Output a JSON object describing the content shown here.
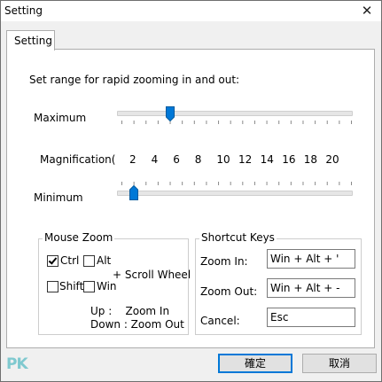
{
  "window": {
    "title": "Setting",
    "close_glyph": "✕"
  },
  "tab": {
    "label": "Setting"
  },
  "range": {
    "heading": "Set range for rapid zooming in and out:",
    "maximum_label": "Maximum",
    "minimum_label": "Minimum",
    "magnification_label": "Magnification(",
    "scale": [
      "2",
      "4",
      "6",
      "8",
      "10",
      "12",
      "14",
      "16",
      "18",
      "20"
    ],
    "maximum_value": 5,
    "minimum_value": 2
  },
  "mouse_zoom": {
    "title": "Mouse Zoom",
    "ctrl_label": "Ctrl",
    "ctrl_checked": true,
    "alt_label": "Alt",
    "alt_checked": false,
    "shift_label": "Shift",
    "shift_checked": false,
    "win_label": "Win",
    "win_checked": false,
    "scroll_label": "+ Scroll Wheel",
    "up_label": "Up :    Zoom In",
    "down_label": "Down : Zoom Out"
  },
  "shortcut_keys": {
    "title": "Shortcut Keys",
    "zoom_in_label": "Zoom In:",
    "zoom_in_value": "Win + Alt + '",
    "zoom_out_label": "Zoom Out:",
    "zoom_out_value": "Win + Alt + -",
    "cancel_label": "Cancel:",
    "cancel_value": "Esc"
  },
  "buttons": {
    "ok": "確定",
    "cancel": "取消"
  },
  "watermark": {
    "text": "PK"
  },
  "colors": {
    "accent": "#0078d7",
    "watermark": "#7fc9cf"
  }
}
